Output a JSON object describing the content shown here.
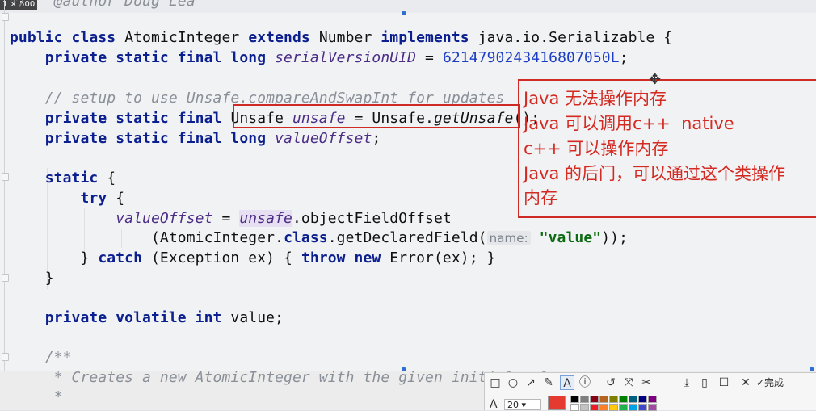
{
  "window": {
    "size_badge": "1 × 500"
  },
  "code": {
    "l0": "*/",
    "l0_author": "@author Doug Lea",
    "l1": {
      "kw1": "public class",
      "name": "AtomicInteger",
      "kw2": "extends",
      "base": "Number",
      "kw3": "implements",
      "iface": "java.io.Serializable {"
    },
    "l2": {
      "kw": "private static final long",
      "field": "serialVersionUID",
      "eq": " = ",
      "num": "6214790243416807050L",
      "end": ";"
    },
    "l4": {
      "comment": "// setup to use Unsafe.compareAndSwapInt for updates"
    },
    "l5": {
      "kw": "private static final",
      "type": "Unsafe",
      "var": "unsafe",
      "eq": " = Unsafe.",
      "call": "getUnsafe",
      "end": "();"
    },
    "l6": {
      "kw": "private static final long",
      "var": "valueOffset",
      "end": ";"
    },
    "l8": {
      "kw": "static",
      "end": " {"
    },
    "l9": {
      "kw": "try",
      "end": " {"
    },
    "l10": {
      "var": "valueOffset",
      "eq": " = ",
      "obj": "unsafe",
      "call": ".objectFieldOffset"
    },
    "l11": {
      "pre": "(AtomicInteger.",
      "kw": "class",
      "mid": ".getDeclaredField(",
      "hint": "name:",
      "str": "\"value\"",
      "end": "));"
    },
    "l12": {
      "pre": "} ",
      "kw1": "catch",
      "mid": " (Exception ex) { ",
      "kw2": "throw new",
      "end": " Error(ex); }"
    },
    "l13": "}",
    "l15": {
      "kw": "private volatile int",
      "end": " value;"
    },
    "l17": "/**",
    "l18": "* Creates a new AtomicInteger with the given initial value.",
    "l19": "*"
  },
  "annotation": {
    "notes": [
      "Java 无法操作内存",
      "Java 可以调用c++  native",
      "c++ 可以操作内存",
      "Java 的后门，可以通过这个类操作",
      "内存"
    ]
  },
  "toolbar": {
    "tools": [
      "□",
      "○",
      "↗",
      "✎",
      "A",
      "ⓘ",
      "↺",
      "⤧",
      "✂",
      "⤓",
      "▯",
      "☐",
      "✕",
      "✓完成"
    ],
    "font_label": "A",
    "font_size": "20",
    "current_color": "#e53a2f",
    "palette": [
      "#000000",
      "#7f7f7f",
      "#880015",
      "#b5651d",
      "#808000",
      "#008000",
      "#006080",
      "#00007f",
      "#7f007f",
      "#ffffff",
      "#c3c3c3",
      "#ed1c24",
      "#ff7f27",
      "#ffc90e",
      "#22b14c",
      "#00a2e8",
      "#3f48cc",
      "#a349a4"
    ]
  }
}
